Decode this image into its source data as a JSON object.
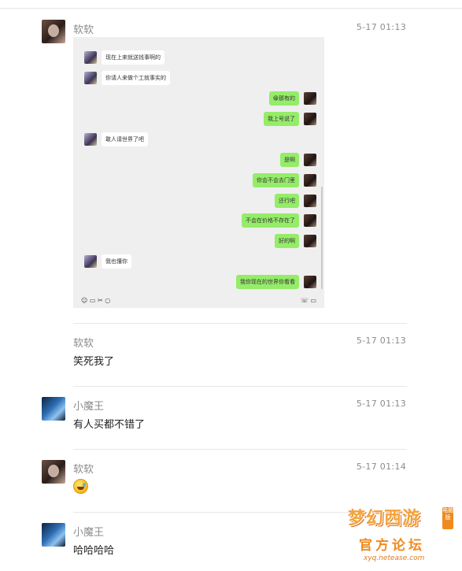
{
  "posts": [
    {
      "name": "软软",
      "time": "5-17 01:13"
    },
    {
      "name": "软软",
      "time": "5-17 01:13",
      "text": "笑死我了"
    },
    {
      "name": "小魔王",
      "time": "5-17 01:13",
      "text": "有人买都不错了"
    },
    {
      "name": "软软",
      "time": "5-17 01:14"
    },
    {
      "name": "小魔王",
      "text": "哈哈哈哈"
    }
  ],
  "chat": {
    "messages": [
      {
        "side": "left",
        "text": "现在上来就送钱事啊的"
      },
      {
        "side": "left",
        "text": "你请人来做个工就事实的"
      },
      {
        "side": "right",
        "text": "😁那有的"
      },
      {
        "side": "right",
        "text": "我上号说了"
      },
      {
        "side": "left",
        "text": "敢人请世界了吧"
      },
      {
        "side": "right",
        "text": "是啊"
      },
      {
        "side": "right",
        "text": "你会不会去门里"
      },
      {
        "side": "right",
        "text": "还行吧"
      },
      {
        "side": "right",
        "text": "不会在价格不存在了"
      },
      {
        "side": "right",
        "text": "好的啊"
      },
      {
        "side": "left",
        "text": "我也懂你"
      },
      {
        "side": "right",
        "text": "我你现在的世界你看看"
      }
    ],
    "toolbar": {
      "left": "☺ ▭ ✂ ○",
      "right": "☏ ▭"
    }
  },
  "watermark": {
    "title": "梦幻西游",
    "subtitle": "官方论坛",
    "url": "xyq.netease.com",
    "tag": "电脑版"
  }
}
